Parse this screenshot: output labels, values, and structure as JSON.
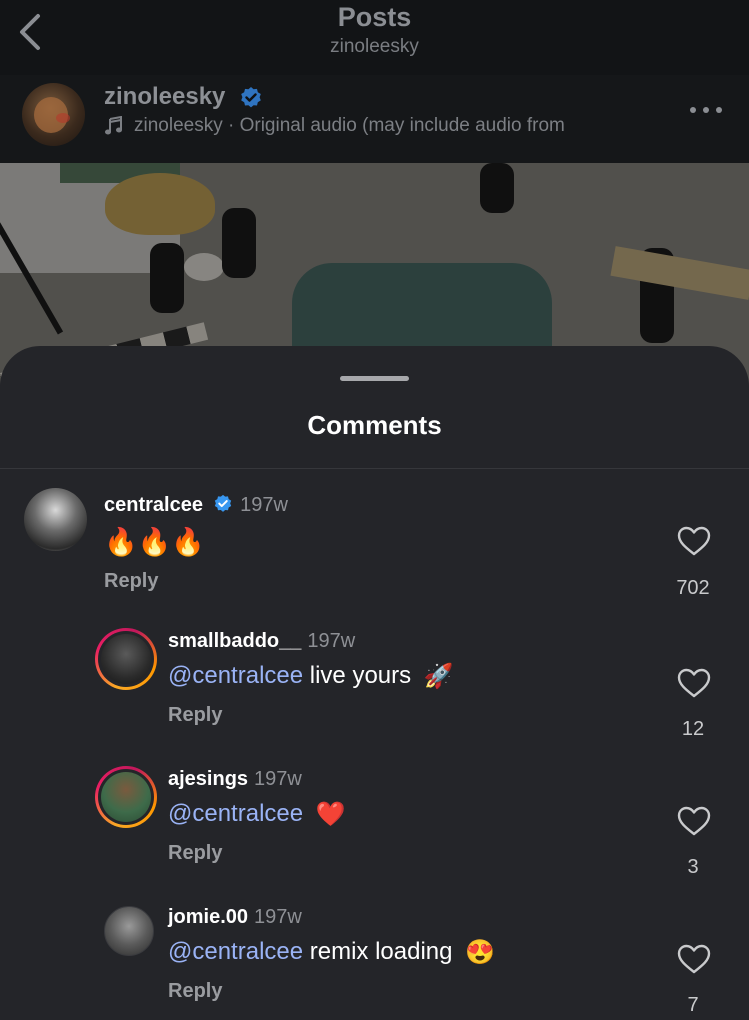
{
  "header": {
    "title": "Posts",
    "subtitle": "zinoleesky"
  },
  "post": {
    "username": "zinoleesky",
    "audio": "zinoleesky · Original audio  (may include audio from"
  },
  "sheet": {
    "title": "Comments"
  },
  "comments": [
    {
      "user": "centralcee",
      "verified": true,
      "time": "197w",
      "mention": "",
      "text": "",
      "emoji": "🔥🔥🔥",
      "reply_label": "Reply",
      "likes": "702"
    },
    {
      "user": "smallbaddo__",
      "time": "197w",
      "mention": "@centralcee",
      "text": " live yours",
      "emoji": "🚀",
      "reply_label": "Reply",
      "likes": "12"
    },
    {
      "user": "ajesings",
      "time": "197w",
      "mention": "@centralcee",
      "text": "",
      "emoji": "❤️",
      "reply_label": "Reply",
      "likes": "3"
    },
    {
      "user": "jomie.00",
      "time": "197w",
      "mention": "@centralcee",
      "text": " remix loading",
      "emoji": "😍",
      "reply_label": "Reply",
      "likes": "7"
    }
  ],
  "colors": {
    "verified": "#3897f0",
    "mention": "#9ab3f5",
    "sheet_background": "#242529"
  },
  "icons": [
    "back-chevron-icon",
    "verified-badge-icon",
    "music-note-icon",
    "more-options-icon",
    "heart-icon"
  ]
}
